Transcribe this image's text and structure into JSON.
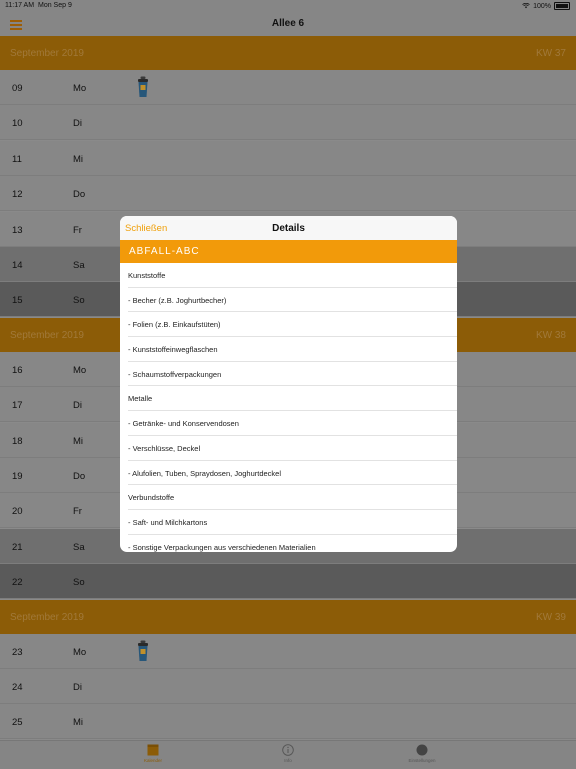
{
  "status_bar": {
    "time": "11:17 AM",
    "date": "Mon Sep 9",
    "battery": "100%"
  },
  "nav": {
    "title": "Allee 6",
    "menu_icon": "hamburger-icon"
  },
  "colors": {
    "accent": "#f29a0a",
    "dimmed_header": "#8c5c07"
  },
  "weeks": [
    {
      "month": "September 2019",
      "kw": "KW 37",
      "days": [
        {
          "num": "09",
          "dow": "Mo",
          "bin": true
        },
        {
          "num": "10",
          "dow": "Di"
        },
        {
          "num": "11",
          "dow": "Mi"
        },
        {
          "num": "12",
          "dow": "Do"
        },
        {
          "num": "13",
          "dow": "Fr"
        },
        {
          "num": "14",
          "dow": "Sa"
        },
        {
          "num": "15",
          "dow": "So"
        }
      ]
    },
    {
      "month": "September 2019",
      "kw": "KW 38",
      "days": [
        {
          "num": "16",
          "dow": "Mo"
        },
        {
          "num": "17",
          "dow": "Di"
        },
        {
          "num": "18",
          "dow": "Mi"
        },
        {
          "num": "19",
          "dow": "Do"
        },
        {
          "num": "20",
          "dow": "Fr"
        },
        {
          "num": "21",
          "dow": "Sa"
        },
        {
          "num": "22",
          "dow": "So"
        }
      ]
    },
    {
      "month": "September 2019",
      "kw": "KW 39",
      "days": [
        {
          "num": "23",
          "dow": "Mo",
          "bin": true
        },
        {
          "num": "24",
          "dow": "Di"
        },
        {
          "num": "25",
          "dow": "Mi"
        }
      ]
    }
  ],
  "modal": {
    "close_label": "Schließen",
    "title": "Details",
    "section_title": "ABFALL-ABC",
    "items": [
      "Kunststoffe",
      "- Becher (z.B. Joghurtbecher)",
      "- Folien (z.B. Einkaufstüten)",
      "- Kunststoffeinwegflaschen",
      "- Schaumstoffverpackungen",
      "Metalle",
      "- Getränke- und Konservendosen",
      "- Verschlüsse, Deckel",
      "- Alufolien, Tuben, Spraydosen, Joghurtdeckel",
      "Verbundstoffe",
      "- Saft- und Milchkartons",
      "- Sonstige Verpackungen aus verschiedenen Materialien"
    ]
  },
  "tabs": [
    {
      "label": "Kalender",
      "icon": "calendar-icon",
      "active": true
    },
    {
      "label": "Info",
      "icon": "info-icon",
      "active": false
    },
    {
      "label": "Einstellungen",
      "icon": "settings-icon",
      "active": false
    }
  ]
}
